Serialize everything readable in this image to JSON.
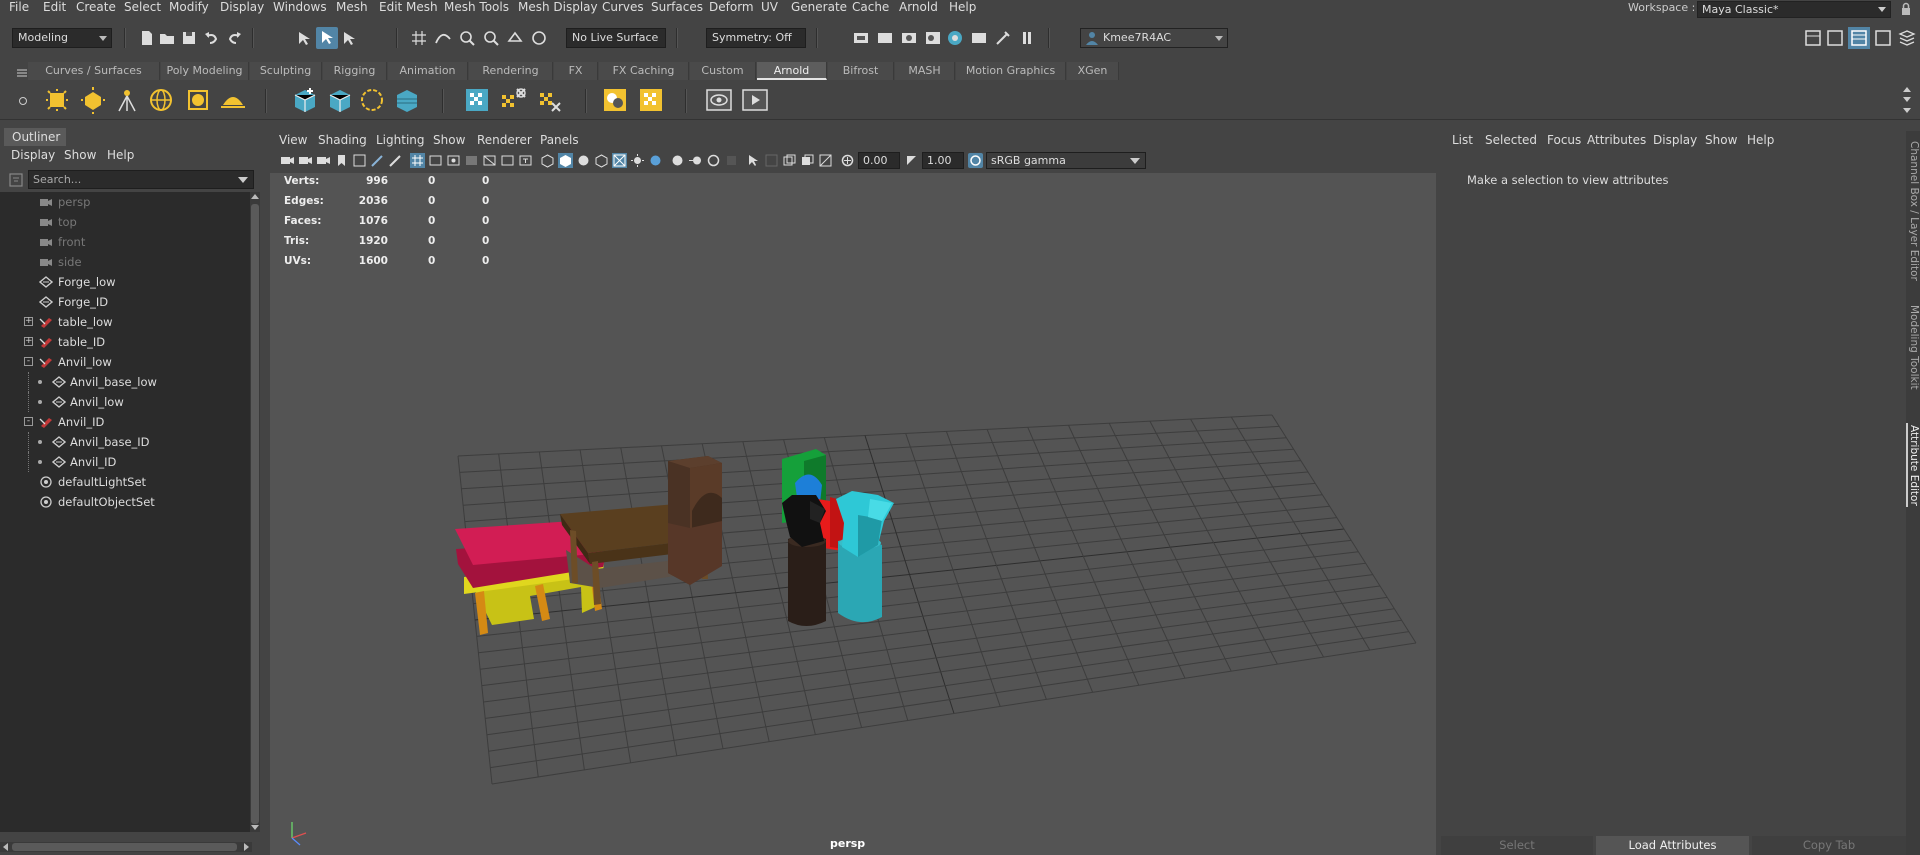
{
  "menubar": {
    "items": [
      "File",
      "Edit",
      "Create",
      "Select",
      "Modify",
      "Display",
      "Windows",
      "Mesh",
      "Edit Mesh",
      "Mesh Tools",
      "Mesh Display",
      "Curves",
      "Surfaces",
      "Deform",
      "UV",
      "Generate",
      "Cache",
      "Arnold",
      "Help"
    ],
    "workspace_label": "Workspace :",
    "workspace_value": "Maya Classic*"
  },
  "statusline": {
    "mode": "Modeling",
    "live_surface": "No Live Surface",
    "symmetry": "Symmetry: Off",
    "user": "Kmee7R4AC"
  },
  "shelf": {
    "tabs": [
      "Curves / Surfaces",
      "Poly Modeling",
      "Sculpting",
      "Rigging",
      "Animation",
      "Rendering",
      "FX",
      "FX Caching",
      "Custom",
      "Arnold",
      "Bifrost",
      "MASH",
      "Motion Graphics",
      "XGen"
    ],
    "active_tab": "Arnold"
  },
  "outliner": {
    "title": "Outliner",
    "menu": [
      "Display",
      "Show",
      "Help"
    ],
    "search_placeholder": "Search...",
    "items": [
      {
        "label": "persp",
        "icon": "camera-icon",
        "dim": true
      },
      {
        "label": "top",
        "icon": "camera-icon",
        "dim": true
      },
      {
        "label": "front",
        "icon": "camera-icon",
        "dim": true
      },
      {
        "label": "side",
        "icon": "camera-icon",
        "dim": true
      },
      {
        "label": "Forge_low",
        "icon": "mesh-icon"
      },
      {
        "label": "Forge_ID",
        "icon": "mesh-icon"
      },
      {
        "label": "table_low",
        "icon": "group-icon",
        "expander": "+"
      },
      {
        "label": "table_ID",
        "icon": "group-icon",
        "expander": "+"
      },
      {
        "label": "Anvil_low",
        "icon": "group-icon",
        "expander": "-"
      },
      {
        "label": "Anvil_base_low",
        "icon": "mesh-icon",
        "child": true
      },
      {
        "label": "Anvil_low",
        "icon": "mesh-icon",
        "child": true
      },
      {
        "label": "Anvil_ID",
        "icon": "group-icon",
        "expander": "-"
      },
      {
        "label": "Anvil_base_ID",
        "icon": "mesh-icon",
        "child": true
      },
      {
        "label": "Anvil_ID",
        "icon": "mesh-icon",
        "child": true
      },
      {
        "label": "defaultLightSet",
        "icon": "set-icon"
      },
      {
        "label": "defaultObjectSet",
        "icon": "set-icon"
      }
    ]
  },
  "viewport": {
    "menu": [
      "View",
      "Shading",
      "Lighting",
      "Show",
      "Renderer",
      "Panels"
    ],
    "exposure": "0.00",
    "gamma": "1.00",
    "color_space": "sRGB gamma",
    "camera": "persp",
    "hud": [
      {
        "label": "Verts:",
        "a": "996",
        "b": "0",
        "c": "0"
      },
      {
        "label": "Edges:",
        "a": "2036",
        "b": "0",
        "c": "0"
      },
      {
        "label": "Faces:",
        "a": "1076",
        "b": "0",
        "c": "0"
      },
      {
        "label": "Tris:",
        "a": "1920",
        "b": "0",
        "c": "0"
      },
      {
        "label": "UVs:",
        "a": "1600",
        "b": "0",
        "c": "0"
      }
    ]
  },
  "attribute_editor": {
    "menu": [
      "List",
      "Selected",
      "Focus",
      "Attributes",
      "Display",
      "Show",
      "Help"
    ],
    "message": "Make a selection to view attributes",
    "buttons": [
      "Select",
      "Load Attributes",
      "Copy Tab"
    ]
  },
  "side_tabs": [
    "Channel Box / Layer Editor",
    "Modeling Toolkit",
    "Attribute Editor"
  ],
  "colors": {
    "accent": "#5285a6",
    "active_tab_underline": "#e4e4e4",
    "viewport_bg": "#545454",
    "panel_bg": "#444444",
    "field_bg": "#2b2b2b"
  }
}
